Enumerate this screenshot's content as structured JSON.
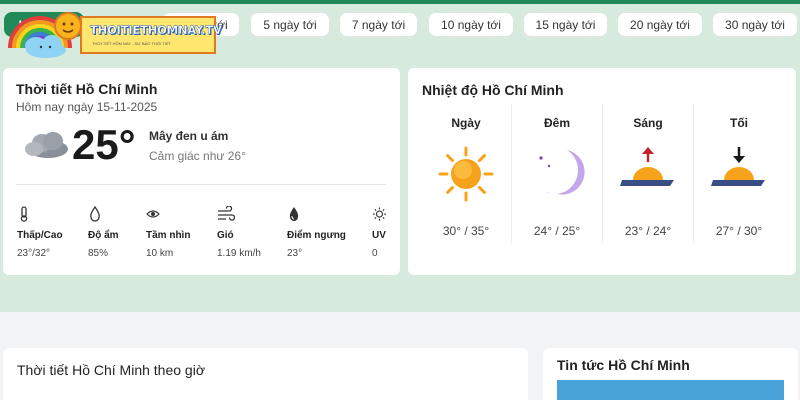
{
  "site": {
    "logo_text": "THOITIETHOMNAY.TV",
    "logo_tagline": "THỜI TIẾT HÔM NAY - DỰ BÁO THỜI TIẾT"
  },
  "tabs": [
    {
      "label": "Hôm nay"
    },
    {
      "label": "3 ngày tới"
    },
    {
      "label": "5 ngày tới"
    },
    {
      "label": "7 ngày tới"
    },
    {
      "label": "10 ngày tới"
    },
    {
      "label": "15 ngày tới"
    },
    {
      "label": "20 ngày tới"
    },
    {
      "label": "30 ngày tới"
    }
  ],
  "current": {
    "title": "Thời tiết Hồ Chí Minh",
    "date": "Hôm nay ngày 15-11-2025",
    "temperature": "25°",
    "condition": "Mây đen u ám",
    "feels_like": "Cảm giác như 26°",
    "icon": "cloud-icon",
    "metrics": [
      {
        "label": "Thấp/Cao",
        "value": "23°/32°",
        "icon": "thermometer-icon"
      },
      {
        "label": "Độ ẩm",
        "value": "85%",
        "icon": "droplet-icon"
      },
      {
        "label": "Tầm nhìn",
        "value": "10 km",
        "icon": "eye-icon"
      },
      {
        "label": "Gió",
        "value": "1.19 km/h",
        "icon": "wind-icon"
      },
      {
        "label": "Điểm ngưng",
        "value": "23°",
        "icon": "dewpoint-icon"
      },
      {
        "label": "UV",
        "value": "0",
        "icon": "sun-outline-icon"
      }
    ]
  },
  "temps": {
    "title": "Nhiệt độ Hồ Chí Minh",
    "periods": [
      {
        "label": "Ngày",
        "value": "30° / 35°",
        "icon": "sun-icon"
      },
      {
        "label": "Đêm",
        "value": "24° / 25°",
        "icon": "moon-icon"
      },
      {
        "label": "Sáng",
        "value": "23° / 24°",
        "icon": "sunrise-icon"
      },
      {
        "label": "Tối",
        "value": "27° / 30°",
        "icon": "sunset-icon"
      }
    ]
  },
  "hourly": {
    "title": "Thời tiết Hồ Chí Minh theo giờ"
  },
  "news": {
    "title": "Tin tức Hồ Chí Minh"
  },
  "colors": {
    "brand_green": "#1f8a57",
    "band": "#d6ebde",
    "sun": "#f7a21b",
    "moon": "#7b3fc4"
  }
}
